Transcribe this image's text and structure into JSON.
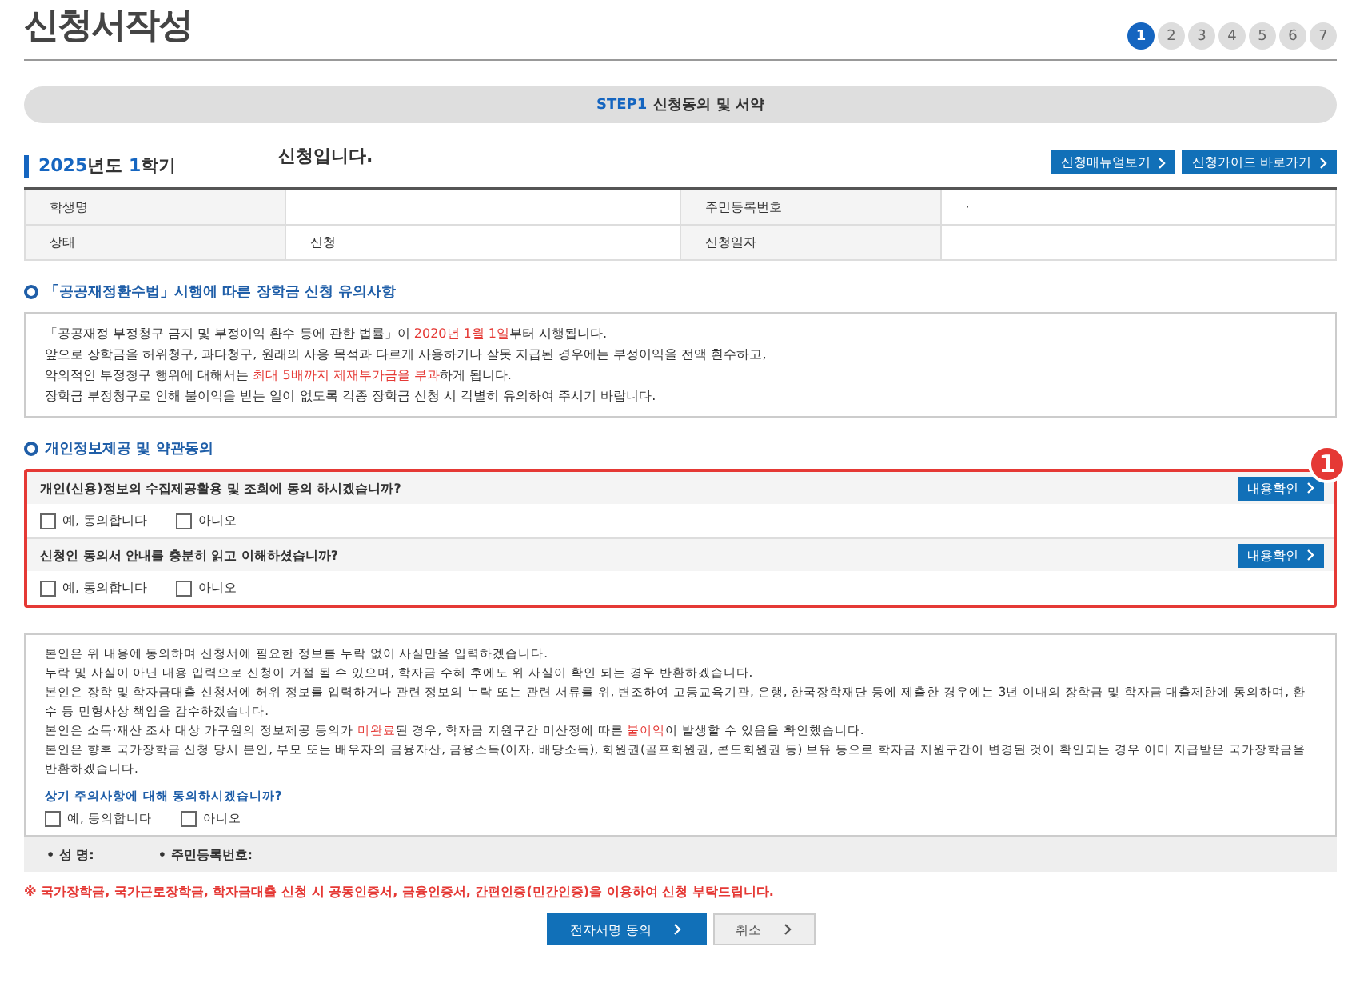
{
  "page_title": "신청서작성",
  "steps": [
    {
      "label": "1",
      "selected": true
    },
    {
      "label": "2",
      "selected": false
    },
    {
      "label": "3",
      "selected": false
    },
    {
      "label": "4",
      "selected": false
    },
    {
      "label": "5",
      "selected": false
    },
    {
      "label": "6",
      "selected": false
    },
    {
      "label": "7",
      "selected": false
    }
  ],
  "step_banner": {
    "step": "STEP1",
    "title": "신청동의 및 서약"
  },
  "term": "**2025**년도 **1**학기",
  "term_notice": "신청입니다.",
  "header_buttons": [
    "신청매뉴얼보기",
    "신청가이드 바로가기"
  ],
  "info_table": [
    [
      {
        "label": "학생명"
      },
      {
        "label": "주민등록번호",
        "value": "·"
      }
    ],
    [
      {
        "label": "상태",
        "value": "신청"
      },
      {
        "label": "신청일자"
      }
    ]
  ],
  "law_section": {
    "title": "「공공재정환수법」시행에 따른 장학금 신청 유의사항",
    "lines": [
      "「공공재정 부정청구 금지 및 부정이익 환수 등에 관한 법률」이 **2020년 1월 1일**부터 시행됩니다.",
      "앞으로 장학금을 허위청구, 과다청구, 원래의 사용 목적과 다르게 사용하거나 잘못 지급된 경우에는 부정이익을 전액 환수하고,",
      "악의적인 부정청구 행위에 대해서는 **최대 5배까지 제재부가금을 부과**하게 됩니다.",
      "장학금 부정청구로 인해 불이익을 받는 일이 없도록 각종 장학금 신청 시 각별히 유의하여 주시기 바랍니다."
    ]
  },
  "consent_section": {
    "title": "개인정보제공 및 약관동의",
    "marker": "1",
    "questions": [
      {
        "text": "개인(신용)정보의 수집제공활용 및 조회에 동의 하시겠습니까?",
        "button": "내용확인",
        "options": [
          {
            "label": "예, 동의합니다",
            "checked": false
          },
          {
            "label": "아니오",
            "checked": false
          }
        ]
      },
      {
        "text": "신청인 동의서 안내를 충분히 읽고 이해하셨습니까?",
        "button": "내용확인",
        "options": [
          {
            "label": "예, 동의합니다",
            "checked": false
          },
          {
            "label": "아니오",
            "checked": false
          }
        ]
      }
    ]
  },
  "pledge": {
    "lines": [
      "본인은 위 내용에 동의하며 신청서에 필요한 정보를 누락 없이 사실만을 입력하겠습니다.",
      "누락 및 사실이 아닌 내용 입력으로 신청이 거절 될 수 있으며, 학자금 수혜 후에도 위 사실이 확인 되는 경우 반환하겠습니다.",
      "본인은 장학 및 학자금대출 신청서에 허위 정보를 입력하거나 관련 정보의 누락 또는 관련 서류를 위, 변조하여 고등교육기관, 은행, 한국장학재단 등에 제출한 경우에는 3년 이내의 장학금 및 학자금 대출제한에 동의하며, 환수 등 민형사상 책임을 감수하겠습니다.",
      "본인은 소득·재산 조사 대상 가구원의 정보제공 동의가 **미완료**된 경우, 학자금 지원구간 미산정에 따른 **불이익**이 발생할 수 있음을 확인했습니다.",
      "본인은 향후 국가장학금 신청 당시 본인, 부모 또는 배우자의 금융자산, 금융소득(이자, 배당소득), 회원권(골프회원권, 콘도회원권 등) 보유 등으로 학자금 지원구간이 변경된 것이 확인되는 경우 이미 지급받은 국가장학금을 반환하겠습니다."
    ],
    "question": "상기 주의사항에 대해 동의하시겠습니까?",
    "options": [
      {
        "label": "예, 동의합니다",
        "checked": false
      },
      {
        "label": "아니오",
        "checked": false
      }
    ]
  },
  "signer_fields": [
    "• 성 명:",
    "• 주민등록번호:"
  ],
  "warning": "※ 국가장학금, 국가근로장학금, 학자금대출 신청 시 공동인증서, 금융인증서, 간편인증(민간인증)을 이용하여 신청 부탁드립니다.",
  "actions": [
    {
      "label": "전자서명 동의",
      "kind": "primary"
    },
    {
      "label": "취소",
      "kind": "secondary"
    }
  ]
}
